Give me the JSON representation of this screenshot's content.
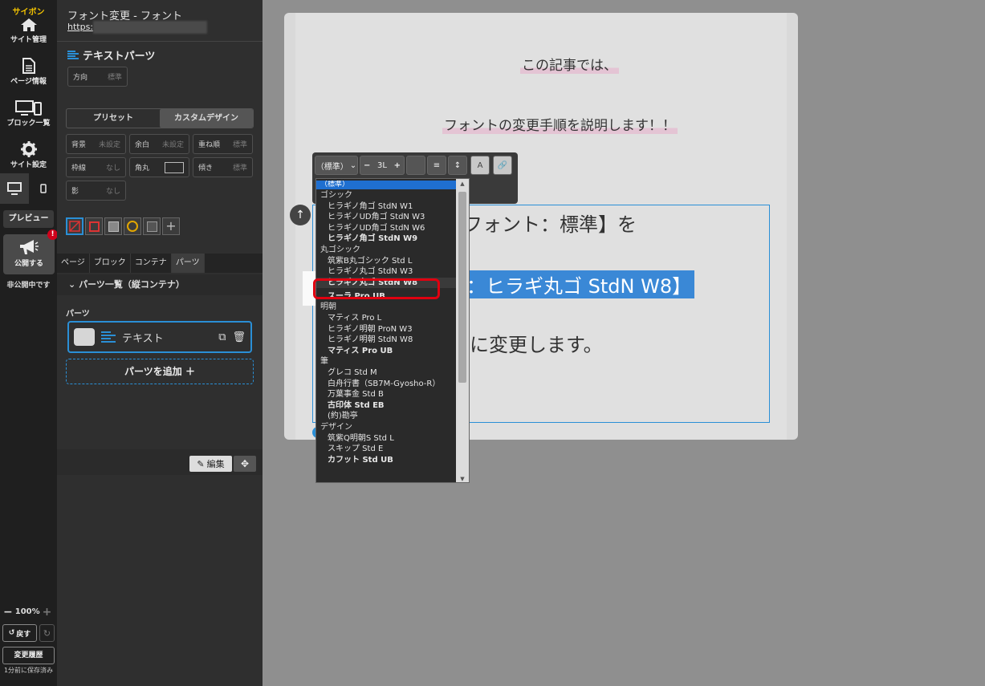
{
  "rail": {
    "brand": "サイボン",
    "site_manage": "サイト管理",
    "page_info": "ページ情報",
    "block_list": "ブロック一覧",
    "site_settings": "サイト設定",
    "preview": "プレビュー",
    "publish": "公開する",
    "publish_badge": "!",
    "unpublished": "非公開中です",
    "zoom": "100%",
    "undo": "戻す",
    "history": "変更履歴",
    "saved": "1分前に保存済み"
  },
  "panel": {
    "page_title": "フォント変更 - フォント",
    "url": "https:",
    "section_title": "テキストパーツ",
    "direction": {
      "label": "方向",
      "value": "標準"
    },
    "tabs": [
      "プリセット",
      "カスタムデザイン"
    ],
    "props": [
      {
        "label": "背景",
        "value": "未設定"
      },
      {
        "label": "余白",
        "value": "未設定"
      },
      {
        "label": "重ね順",
        "value": "標準"
      },
      {
        "label": "枠線",
        "value": "なし"
      },
      {
        "label": "角丸",
        "value": ""
      },
      {
        "label": "傾き",
        "value": "標準"
      },
      {
        "label": "影",
        "value": "なし"
      }
    ],
    "nav_tabs": [
      "ページ",
      "ブロック",
      "コンテナ",
      "パーツ"
    ],
    "container_head": "パーツ一覧（縦コンテナ）",
    "parts_label": "パーツ",
    "part_name": "テキスト",
    "add_part": "パーツを追加",
    "edit": "編集"
  },
  "canvas": {
    "line1": "この記事では、",
    "line2": "フォントの変更手順を説明します！！",
    "body1": "フォント：標準】を",
    "body2": "：ヒラギ丸ゴ StdN W8】",
    "body3": "に変更します。"
  },
  "toolbar": {
    "font_select": "（標準）",
    "size": "3L",
    "color_btn": "A"
  },
  "font_dropdown": {
    "selected_top": "（標準）",
    "items": [
      {
        "text": "ゴシック",
        "type": "group"
      },
      {
        "text": "ヒラギノ角ゴ StdN W1",
        "type": "item"
      },
      {
        "text": "ヒラギノUD角ゴ StdN W3",
        "type": "item"
      },
      {
        "text": "ヒラギノUD角ゴ StdN W6",
        "type": "item"
      },
      {
        "text": "ヒラギノ角ゴ StdN W9",
        "type": "item"
      },
      {
        "text": "丸ゴシック",
        "type": "group"
      },
      {
        "text": "筑紫B丸ゴシック Std L",
        "type": "item"
      },
      {
        "text": "ヒラギノ丸ゴ StdN W3",
        "type": "item"
      },
      {
        "text": "ヒラギノ丸ゴ StdN W8",
        "type": "item"
      },
      {
        "text": "スーラ Pro UB",
        "type": "item"
      },
      {
        "text": "明朝",
        "type": "group"
      },
      {
        "text": "マティス Pro L",
        "type": "item"
      },
      {
        "text": "ヒラギノ明朝 ProN W3",
        "type": "item"
      },
      {
        "text": "ヒラギノ明朝 StdN W8",
        "type": "item"
      },
      {
        "text": "マティス Pro UB",
        "type": "item"
      },
      {
        "text": "筆",
        "type": "group"
      },
      {
        "text": "グレコ Std M",
        "type": "item"
      },
      {
        "text": "白舟行書（SB7M-Gyosho-R）",
        "type": "item"
      },
      {
        "text": "万葉事金 Std B",
        "type": "item"
      },
      {
        "text": "古印体 Std EB",
        "type": "item"
      },
      {
        "text": "(約)勘亭",
        "type": "item"
      },
      {
        "text": "デザイン",
        "type": "group"
      },
      {
        "text": "筑紫Q明朝S Std L",
        "type": "item"
      },
      {
        "text": "スキップ Std E",
        "type": "item"
      },
      {
        "text": "カフット Std UB",
        "type": "item"
      }
    ]
  },
  "colors": {
    "accent": "#2a8fd6",
    "highlight_ring": "#e00010",
    "selection": "#3a88d6"
  }
}
